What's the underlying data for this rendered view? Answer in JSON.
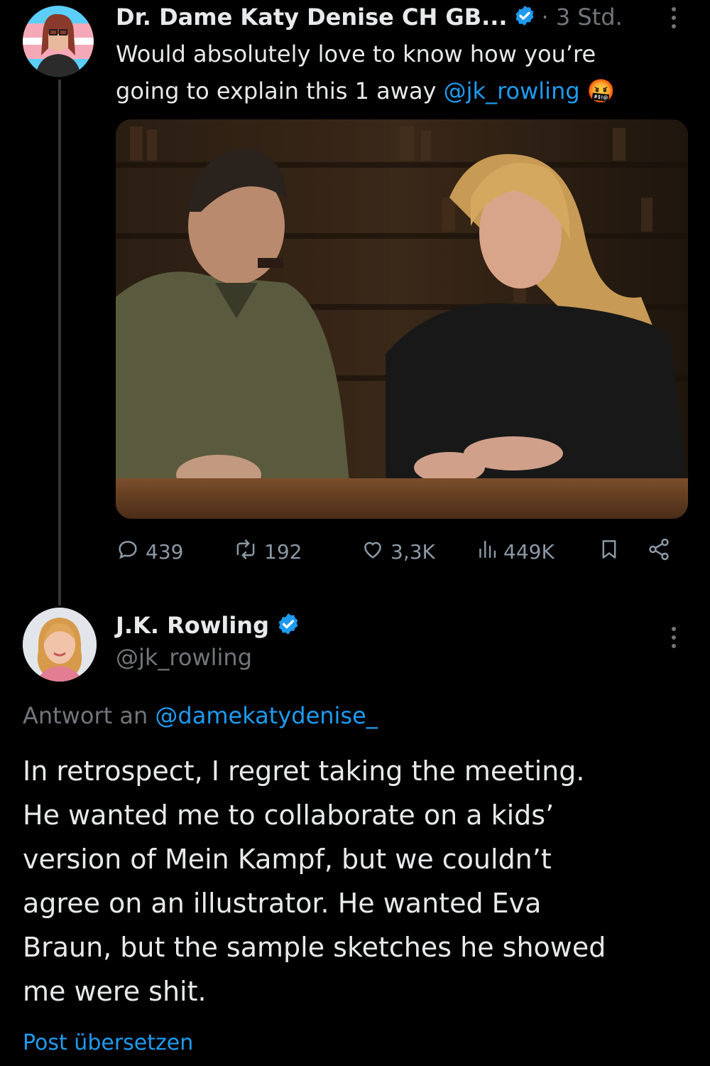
{
  "tweet1": {
    "author_name": "Dr. Dame Katy Denise CH GB...",
    "time": "· 3 Std.",
    "text_line1": "Would absolutely love to know how you’re",
    "text_line2_prefix": "going to explain this 1 away ",
    "mention": "@jk_rowling",
    "emoji": "🤬",
    "stats": {
      "replies": "439",
      "reposts": "192",
      "likes": "3,3K",
      "views": "449K"
    }
  },
  "tweet2": {
    "author_name": "J.K. Rowling",
    "handle": "@jk_rowling",
    "reply_prefix": "Antwort an ",
    "reply_to": "@damekatydenise_",
    "text_lines": [
      "In retrospect, I regret taking the meeting.",
      "He wanted me to collaborate on a kids’",
      "version of Mein Kampf, but we couldn’t",
      "agree on an illustrator. He wanted Eva",
      "Braun, but the sample sketches he showed",
      "me were shit."
    ],
    "translate": "Post übersetzen"
  },
  "colors": {
    "accent": "#1d9bf0",
    "muted": "#71767b",
    "background": "#000000"
  },
  "icons": [
    "reply-icon",
    "repost-icon",
    "like-icon",
    "views-icon",
    "bookmark-icon",
    "share-icon",
    "verified-icon",
    "more-icon"
  ]
}
